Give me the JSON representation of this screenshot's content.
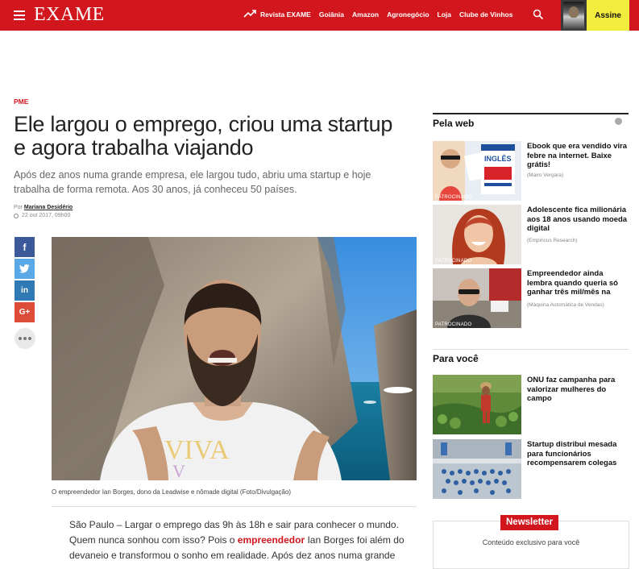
{
  "header": {
    "logo": "EXAME",
    "nav": [
      "Revista EXAME",
      "Goiânia",
      "Amazon",
      "Agronegócio",
      "Loja",
      "Clube de Vinhos"
    ],
    "subscribe_label": "Assine",
    "icons": [
      "menu-icon",
      "trending-icon",
      "search-icon"
    ]
  },
  "article": {
    "kicker": "PME",
    "headline": "Ele largou o emprego, criou uma startup e agora trabalha viajando",
    "dek": "Após dez anos numa grande empresa, ele largou tudo, abriu uma startup e hoje trabalha de forma remota. Aos 30 anos, já conheceu 50 países.",
    "byline_prefix": "Por",
    "author": "Mariana Desidério",
    "date": "22 out 2017, 09h00",
    "image_caption": "O empreendedor Ian Borges, dono da Leadwise e nômade digital (Foto/Divulgação)",
    "body_1": "São Paulo – Largar o emprego das 9h às 18h e sair para conhecer o mundo. Quem nunca sonhou com isso? Pois o ",
    "body_link": "empreendedor",
    "body_2": " Ian Borges foi além do devaneio e transformou o sonho em realidade. Após dez anos numa grande"
  },
  "share": {
    "facebook": "f",
    "twitter": "t",
    "linkedin": "in",
    "googleplus": "G+"
  },
  "sidebar": {
    "pela_web_title": "Pela web",
    "sponsored_label": "PATROCINADO",
    "pela_web": [
      {
        "title": "Ebook que era vendido vira febre na internet. Baixe grátis!",
        "source": "(Mairo Vergara)"
      },
      {
        "title": "Adolescente fica milionária aos 18 anos usando moeda digital",
        "source": "(Empiricus Research)"
      },
      {
        "title": "Empreendedor ainda lembra quando queria só ganhar três mil/mês na",
        "source": "(Máquina Automática de Vendas)"
      }
    ],
    "para_voce_title": "Para você",
    "para_voce": [
      {
        "title": "ONU faz campanha para valorizar mulheres do campo"
      },
      {
        "title": "Startup distribui mesada para funcionários recompensarem colegas"
      }
    ],
    "newsletter_label": "Newsletter",
    "newsletter_sub": "Conteúdo exclusivo para você"
  }
}
